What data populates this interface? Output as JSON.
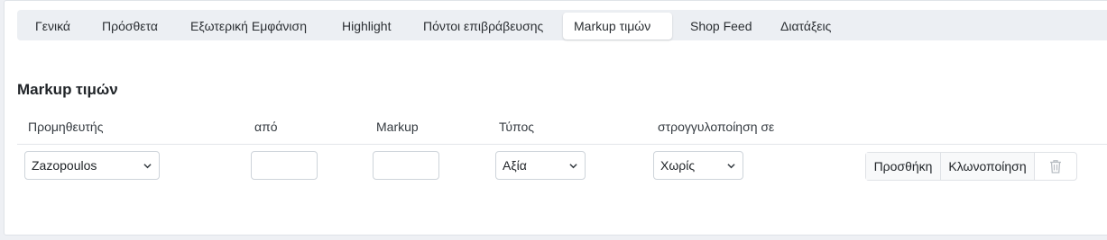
{
  "tabs": [
    {
      "label": "Γενικά",
      "active": false
    },
    {
      "label": "Πρόσθετα",
      "active": false
    },
    {
      "label": "Εξωτερική Εμφάνιση",
      "active": false
    },
    {
      "label": "Highlight",
      "active": false
    },
    {
      "label": "Πόντοι επιβράβευσης",
      "active": false
    },
    {
      "label": "Markup τιμών",
      "active": true
    },
    {
      "label": "Shop Feed",
      "active": false
    },
    {
      "label": "Διατάξεις",
      "active": false
    }
  ],
  "section": {
    "title": "Markup τιμών"
  },
  "table": {
    "headers": {
      "supplier": "Προμηθευτής",
      "from": "από",
      "markup": "Markup",
      "type": "Τύπος",
      "rounding": "στρογγυλοποίηση σε"
    },
    "row": {
      "supplier": "Zazopoulos",
      "from": "",
      "markup": "",
      "type": "Αξία",
      "rounding": "Χωρίς"
    },
    "actions": {
      "add": "Προσθήκη",
      "clone": "Κλωνοποίηση",
      "delete_icon": "trash-icon"
    }
  }
}
